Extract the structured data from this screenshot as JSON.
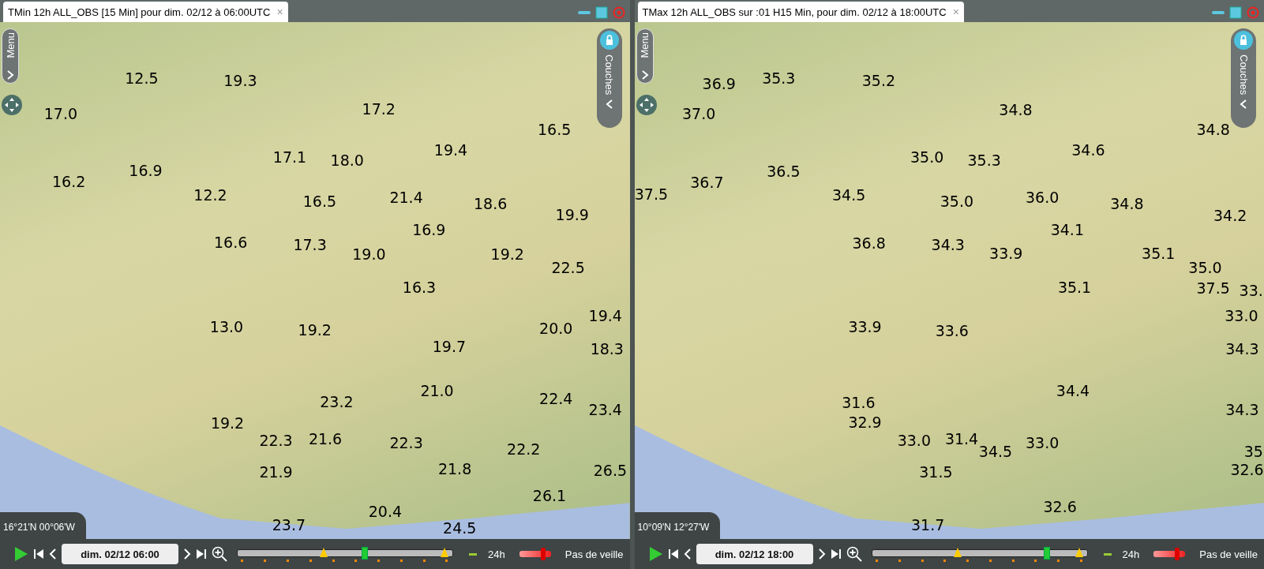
{
  "panels": [
    {
      "title": "TMin 12h ALL_OBS [15 Min] pour dim. 02/12 à 06:00UTC",
      "close": "×",
      "menu_label": "Menu",
      "layers_label": "Couches",
      "coordinates": "16°21'N 00°06'W",
      "date": "dim. 02/12 06:00",
      "timeline": {
        "level": 0.59
      },
      "range": "24h",
      "speed": {
        "level": 0.75
      },
      "watch": "Pas de veille",
      "observations": [
        "12.5",
        "19.3",
        "17.0",
        "17.2",
        "16.5",
        "17.1",
        "18.0",
        "19.4",
        "16.9",
        "16.2",
        "12.2",
        "16.5",
        "21.4",
        "18.6",
        "19.9",
        "16.6",
        "17.3",
        "19.0",
        "16.9",
        "19.2",
        "22.5",
        "16.3",
        "13.0",
        "19.2",
        "20.0",
        "19.4",
        "18.3",
        "19.7",
        "21.0",
        "23.2",
        "22.4",
        "23.4",
        "19.2",
        "22.3",
        "21.6",
        "22.3",
        "22.2",
        "21.9",
        "21.8",
        "26.5",
        "26.1",
        "23.7",
        "20.4",
        "24.5"
      ]
    },
    {
      "title": "TMax 12h ALL_OBS sur :01 H15 Min,  pour dim. 02/12 à 18:00UTC",
      "close": "×",
      "menu_label": "Menu",
      "layers_label": "Couches",
      "coordinates": "10°09'N 12°27'W",
      "date": "dim. 02/12 18:00",
      "timeline": {
        "level": 0.81
      },
      "range": "24h",
      "speed": {
        "level": 0.75
      },
      "watch": "Pas de veille",
      "observations": [
        "36.9",
        "35.3",
        "35.2",
        "37.0",
        "34.8",
        "34.8",
        "35.0",
        "35.3",
        "34.6",
        "36.7",
        "36.5",
        "37.5",
        "34.5",
        "35.0",
        "36.0",
        "34.8",
        "34.2",
        "36.8",
        "34.3",
        "34.1",
        "33.9",
        "35.1",
        "35.0",
        "35.1",
        "37.5",
        "33.",
        "33.0",
        "33.9",
        "33.6",
        "34.3",
        "34.4",
        "34.3",
        "31.6",
        "32.9",
        "33.0",
        "31.4",
        "34.5",
        "33.0",
        "35",
        "31.5",
        "32.6",
        "32.6",
        "31.7"
      ]
    }
  ]
}
